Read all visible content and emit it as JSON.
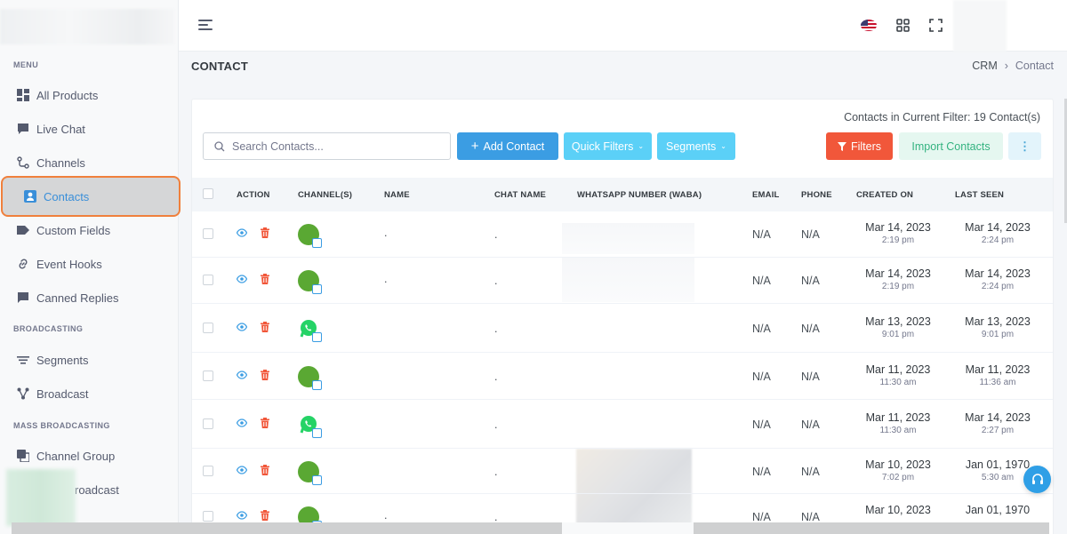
{
  "sidebar": {
    "sections": {
      "menu": "MENU",
      "broadcasting": "BROADCASTING",
      "mass_broadcasting": "MASS BROADCASTING"
    },
    "items": [
      {
        "label": "All Products",
        "icon": "grid-icon"
      },
      {
        "label": "Live Chat",
        "icon": "chat-icon"
      },
      {
        "label": "Channels",
        "icon": "channels-icon"
      },
      {
        "label": "Contacts",
        "icon": "contact-card-icon",
        "active": true
      },
      {
        "label": "Custom Fields",
        "icon": "tag-icon"
      },
      {
        "label": "Event Hooks",
        "icon": "link-icon"
      },
      {
        "label": "Canned Replies",
        "icon": "message-icon"
      },
      {
        "label": "Segments",
        "icon": "filter-lines-icon"
      },
      {
        "label": "Broadcast",
        "icon": "nodes-icon"
      },
      {
        "label": "Channel Group",
        "icon": "copy-icon"
      },
      {
        "label": "roadcast",
        "icon": "broadcast-icon"
      }
    ]
  },
  "header": {
    "icons": [
      "menu-icon",
      "us-flag-icon",
      "apps-grid-icon",
      "fullscreen-icon"
    ]
  },
  "page": {
    "title": "CONTACT",
    "breadcrumb": [
      "CRM",
      "›",
      "Contact"
    ]
  },
  "toolbar": {
    "filter_count": "Contacts in Current Filter: 19 Contact(s)",
    "search_placeholder": "Search Contacts...",
    "add_contact": "Add Contact",
    "quick_filters": "Quick Filters",
    "segments": "Segments",
    "filters": "Filters",
    "import_contacts": "Import Contacts"
  },
  "table": {
    "columns": [
      "ACTION",
      "CHANNEL(S)",
      "NAME",
      "CHAT NAME",
      "WHATSAPP NUMBER (WABA)",
      "EMAIL",
      "PHONE",
      "CREATED ON",
      "LAST SEEN"
    ],
    "rows": [
      {
        "channel": "webchat",
        "name": ".",
        "chat_name": ".",
        "email": "N/A",
        "phone": "N/A",
        "created_date": "Mar 14, 2023",
        "created_time": "2:19 pm",
        "seen_date": "Mar 14, 2023",
        "seen_time": "2:24 pm"
      },
      {
        "channel": "webchat",
        "name": ".",
        "chat_name": ".",
        "email": "N/A",
        "phone": "N/A",
        "created_date": "Mar 14, 2023",
        "created_time": "2:19 pm",
        "seen_date": "Mar 14, 2023",
        "seen_time": "2:24 pm"
      },
      {
        "channel": "whatsapp",
        "name": "",
        "chat_name": ".",
        "email": "N/A",
        "phone": "N/A",
        "created_date": "Mar 13, 2023",
        "created_time": "9:01 pm",
        "seen_date": "Mar 13, 2023",
        "seen_time": "9:01 pm"
      },
      {
        "channel": "webchat",
        "name": "",
        "chat_name": ".",
        "email": "N/A",
        "phone": "N/A",
        "created_date": "Mar 11, 2023",
        "created_time": "11:30 am",
        "seen_date": "Mar 11, 2023",
        "seen_time": "11:36 am"
      },
      {
        "channel": "whatsapp",
        "name": "",
        "chat_name": ".",
        "email": "N/A",
        "phone": "N/A",
        "created_date": "Mar 11, 2023",
        "created_time": "11:30 am",
        "seen_date": "Mar 14, 2023",
        "seen_time": "2:27 pm"
      },
      {
        "channel": "webchat",
        "name": "",
        "chat_name": ".",
        "email": "N/A",
        "phone": "N/A",
        "created_date": "Mar 10, 2023",
        "created_time": "7:02 pm",
        "seen_date": "Jan 01, 1970",
        "seen_time": "5:30 am"
      },
      {
        "channel": "webchat",
        "name": ".",
        "chat_name": ".",
        "email": "N/A",
        "phone": "N/A",
        "created_date": "Mar 10, 2023",
        "created_time": "",
        "seen_date": "Jan 01, 1970",
        "seen_time": ""
      }
    ]
  },
  "colors": {
    "primary": "#3b9de3",
    "info": "#5bd0f7",
    "danger": "#f1573a",
    "success_soft": "#e5f7f0",
    "active_border": "#f0803c",
    "webchat_green": "#5aa833",
    "whatsapp_green": "#25d366"
  }
}
